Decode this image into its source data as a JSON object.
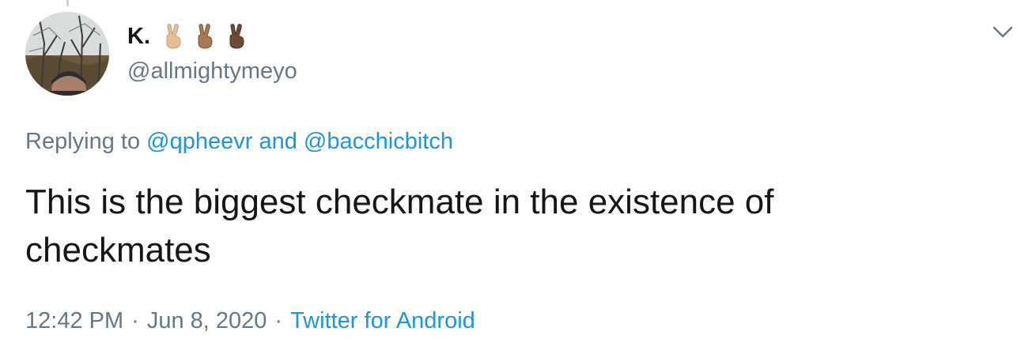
{
  "tweet": {
    "display_name": "K.",
    "handle": "@allmightymeyo",
    "name_emojis": [
      {
        "icon": "victory-hand-light-skin-icon",
        "color": "#e8be96"
      },
      {
        "icon": "victory-hand-medium-skin-icon",
        "color": "#a87953"
      },
      {
        "icon": "victory-hand-dark-skin-icon",
        "color": "#6e4b32"
      }
    ],
    "replying_prefix": "Replying to",
    "reply_to_1": "@qpheevr",
    "reply_and": "and",
    "reply_to_2": "@bacchicbitch",
    "text_line_1": "This is the biggest checkmate in the existence of",
    "text_line_2": "checkmates",
    "time": "12:42 PM",
    "separator": "·",
    "date": "Jun 8, 2020",
    "source": "Twitter for Android"
  },
  "icons": {
    "more_menu": "chevron-down-icon",
    "avatar": "avatar"
  },
  "colors": {
    "link": "#1b95e0",
    "secondary_text": "#657786",
    "primary_text": "#14171a"
  }
}
